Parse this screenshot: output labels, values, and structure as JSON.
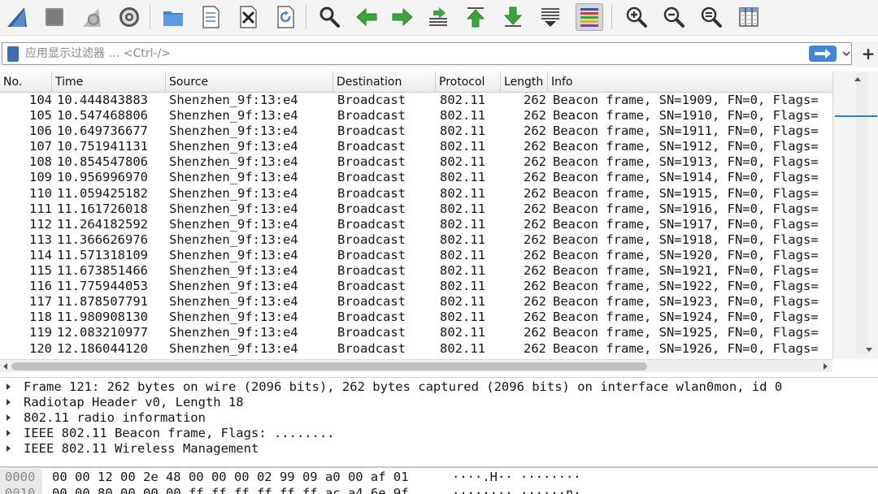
{
  "toolbar": {
    "buttons": [
      {
        "name": "start-capture",
        "icon": "shark-fin-icon"
      },
      {
        "name": "stop-capture",
        "icon": "stop-square-icon"
      },
      {
        "name": "restart-capture",
        "icon": "restart-fin-icon"
      },
      {
        "name": "capture-options",
        "icon": "gear-icon"
      },
      {
        "name": "open-file",
        "icon": "folder-icon"
      },
      {
        "name": "save-file",
        "icon": "document-icon"
      },
      {
        "name": "close-file",
        "icon": "close-document-icon"
      },
      {
        "name": "reload-file",
        "icon": "reload-icon"
      },
      {
        "name": "find-packet",
        "icon": "magnifier-icon"
      },
      {
        "name": "go-back",
        "icon": "arrow-left-icon"
      },
      {
        "name": "go-forward",
        "icon": "arrow-right-icon"
      },
      {
        "name": "go-to-packet",
        "icon": "jump-to-packet-icon"
      },
      {
        "name": "go-first",
        "icon": "arrow-up-first-icon"
      },
      {
        "name": "go-last",
        "icon": "arrow-down-last-icon"
      },
      {
        "name": "auto-scroll",
        "icon": "auto-scroll-icon"
      },
      {
        "name": "colorize",
        "icon": "colorize-lines-icon",
        "active": true
      },
      {
        "name": "zoom-in",
        "icon": "zoom-in-icon"
      },
      {
        "name": "zoom-out",
        "icon": "zoom-out-icon"
      },
      {
        "name": "normal-size",
        "icon": "zoom-reset-icon"
      },
      {
        "name": "resize-columns",
        "icon": "resize-columns-icon"
      }
    ],
    "colors": {
      "accent_blue": "#2f5fa8",
      "accent_green": "#3aa63a",
      "folder_blue": "#3f86d9"
    }
  },
  "filter": {
    "placeholder": "应用显示过滤器 … <Ctrl-/>",
    "apply_icon": "arrow-right-icon",
    "dropdown_icon": "chevron-down-icon",
    "add_label": "+"
  },
  "packet_list": {
    "columns": [
      "No.",
      "Time",
      "Source",
      "Destination",
      "Protocol",
      "Length",
      "Info"
    ],
    "rows": [
      {
        "no": "104",
        "time": "10.444843883",
        "source": "Shenzhen_9f:13:e4",
        "destination": "Broadcast",
        "protocol": "802.11",
        "length": "262",
        "info": "Beacon frame, SN=1909, FN=0, Flags="
      },
      {
        "no": "105",
        "time": "10.547468806",
        "source": "Shenzhen_9f:13:e4",
        "destination": "Broadcast",
        "protocol": "802.11",
        "length": "262",
        "info": "Beacon frame, SN=1910, FN=0, Flags="
      },
      {
        "no": "106",
        "time": "10.649736677",
        "source": "Shenzhen_9f:13:e4",
        "destination": "Broadcast",
        "protocol": "802.11",
        "length": "262",
        "info": "Beacon frame, SN=1911, FN=0, Flags="
      },
      {
        "no": "107",
        "time": "10.751941131",
        "source": "Shenzhen_9f:13:e4",
        "destination": "Broadcast",
        "protocol": "802.11",
        "length": "262",
        "info": "Beacon frame, SN=1912, FN=0, Flags="
      },
      {
        "no": "108",
        "time": "10.854547806",
        "source": "Shenzhen_9f:13:e4",
        "destination": "Broadcast",
        "protocol": "802.11",
        "length": "262",
        "info": "Beacon frame, SN=1913, FN=0, Flags="
      },
      {
        "no": "109",
        "time": "10.956996970",
        "source": "Shenzhen_9f:13:e4",
        "destination": "Broadcast",
        "protocol": "802.11",
        "length": "262",
        "info": "Beacon frame, SN=1914, FN=0, Flags="
      },
      {
        "no": "110",
        "time": "11.059425182",
        "source": "Shenzhen_9f:13:e4",
        "destination": "Broadcast",
        "protocol": "802.11",
        "length": "262",
        "info": "Beacon frame, SN=1915, FN=0, Flags="
      },
      {
        "no": "111",
        "time": "11.161726018",
        "source": "Shenzhen_9f:13:e4",
        "destination": "Broadcast",
        "protocol": "802.11",
        "length": "262",
        "info": "Beacon frame, SN=1916, FN=0, Flags="
      },
      {
        "no": "112",
        "time": "11.264182592",
        "source": "Shenzhen_9f:13:e4",
        "destination": "Broadcast",
        "protocol": "802.11",
        "length": "262",
        "info": "Beacon frame, SN=1917, FN=0, Flags="
      },
      {
        "no": "113",
        "time": "11.366626976",
        "source": "Shenzhen_9f:13:e4",
        "destination": "Broadcast",
        "protocol": "802.11",
        "length": "262",
        "info": "Beacon frame, SN=1918, FN=0, Flags="
      },
      {
        "no": "114",
        "time": "11.571318109",
        "source": "Shenzhen_9f:13:e4",
        "destination": "Broadcast",
        "protocol": "802.11",
        "length": "262",
        "info": "Beacon frame, SN=1920, FN=0, Flags="
      },
      {
        "no": "115",
        "time": "11.673851466",
        "source": "Shenzhen_9f:13:e4",
        "destination": "Broadcast",
        "protocol": "802.11",
        "length": "262",
        "info": "Beacon frame, SN=1921, FN=0, Flags="
      },
      {
        "no": "116",
        "time": "11.775944053",
        "source": "Shenzhen_9f:13:e4",
        "destination": "Broadcast",
        "protocol": "802.11",
        "length": "262",
        "info": "Beacon frame, SN=1922, FN=0, Flags="
      },
      {
        "no": "117",
        "time": "11.878507791",
        "source": "Shenzhen_9f:13:e4",
        "destination": "Broadcast",
        "protocol": "802.11",
        "length": "262",
        "info": "Beacon frame, SN=1923, FN=0, Flags="
      },
      {
        "no": "118",
        "time": "11.980908130",
        "source": "Shenzhen_9f:13:e4",
        "destination": "Broadcast",
        "protocol": "802.11",
        "length": "262",
        "info": "Beacon frame, SN=1924, FN=0, Flags="
      },
      {
        "no": "119",
        "time": "12.083210977",
        "source": "Shenzhen_9f:13:e4",
        "destination": "Broadcast",
        "protocol": "802.11",
        "length": "262",
        "info": "Beacon frame, SN=1925, FN=0, Flags="
      },
      {
        "no": "120",
        "time": "12.186044120",
        "source": "Shenzhen_9f:13:e4",
        "destination": "Broadcast",
        "protocol": "802.11",
        "length": "262",
        "info": "Beacon frame, SN=1926, FN=0, Flags="
      }
    ]
  },
  "details": {
    "items": [
      "Frame 121: 262 bytes on wire (2096 bits), 262 bytes captured (2096 bits) on interface wlan0mon, id 0",
      "Radiotap Header v0, Length 18",
      "802.11 radio information",
      "IEEE 802.11 Beacon frame, Flags: ........",
      "IEEE 802.11 Wireless Management"
    ]
  },
  "bytes": {
    "rows": [
      {
        "offset": "0000",
        "hex": "00 00 12 00 2e 48 00 00  00 02 99 09 a0 00 af 01",
        "ascii": "····.H·· ········"
      },
      {
        "offset": "0010",
        "hex": "00 00 80 00 00 00 ff ff  ff ff ff ff ac a4 6e 9f",
        "ascii": "········ ······n·"
      }
    ]
  }
}
